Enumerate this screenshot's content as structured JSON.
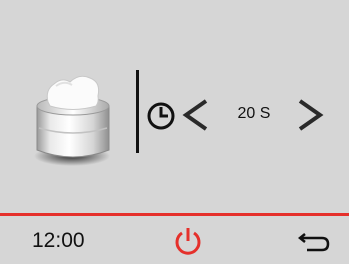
{
  "program": {
    "duration_label": "20 S",
    "icons": {
      "product": "cream-jar-icon",
      "timer": "timer-icon",
      "decrease": "chevron-left-icon",
      "increase": "chevron-right-icon"
    }
  },
  "footer": {
    "time": "12:00",
    "icons": {
      "power": "power-icon",
      "back": "back-arrow-icon"
    }
  },
  "colors": {
    "background": "#d6d6d6",
    "accent": "#e5302b",
    "text": "#111111"
  }
}
